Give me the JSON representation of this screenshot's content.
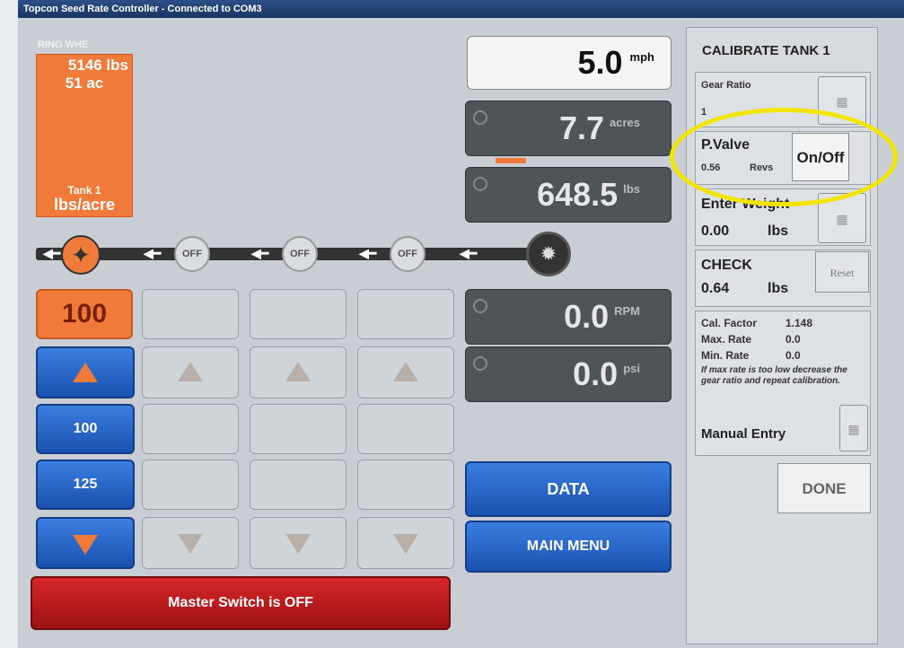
{
  "window": {
    "title": "Topcon Seed Rate Controller - Connected to COM3"
  },
  "tank": {
    "name": "RING WHE",
    "weight": "5146 lbs",
    "area": "51 ac",
    "tank_label": "Tank 1",
    "unit": "lbs/acre"
  },
  "readouts": {
    "speed": {
      "value": "5.0",
      "unit": "mph"
    },
    "acres": {
      "value": "7.7",
      "unit": "acres"
    },
    "lbs": {
      "value": "648.5",
      "unit": "lbs"
    },
    "rpm": {
      "value": "0.0",
      "unit": "RPM"
    },
    "psi": {
      "value": "0.0",
      "unit": "psi"
    }
  },
  "flow": {
    "off1": "OFF",
    "off2": "OFF",
    "off3": "OFF"
  },
  "controls": {
    "rate": "100",
    "preset1": "100",
    "preset2": "125"
  },
  "buttons": {
    "data": "DATA",
    "main_menu": "MAIN MENU",
    "master": "Master Switch is OFF",
    "on_off": "On/Off",
    "reset": "Reset",
    "done": "DONE"
  },
  "calibrate": {
    "title": "CALIBRATE TANK 1",
    "gear_ratio_label": "Gear Ratio",
    "gear_ratio_value": "1",
    "pvalve_label": "P.Valve",
    "pvalve_value": "0.56",
    "pvalve_unit": "Revs",
    "enter_weight_label": "Enter Weight",
    "enter_weight_value": "0.00",
    "enter_weight_unit": "lbs",
    "check_label": "CHECK",
    "check_value": "0.64",
    "check_unit": "lbs",
    "cal_factor_label": "Cal. Factor",
    "cal_factor_value": "1.148",
    "max_rate_label": "Max. Rate",
    "max_rate_value": "0.0",
    "min_rate_label": "Min. Rate",
    "min_rate_value": "0.0",
    "note": "If max rate is too low decrease the gear ratio and repeat calibration.",
    "manual_entry": "Manual Entry"
  },
  "colors": {
    "accent_orange": "#f07a3a",
    "button_blue": "#1a52b0",
    "master_red": "#c01a1d",
    "highlight": "#f2e600"
  }
}
